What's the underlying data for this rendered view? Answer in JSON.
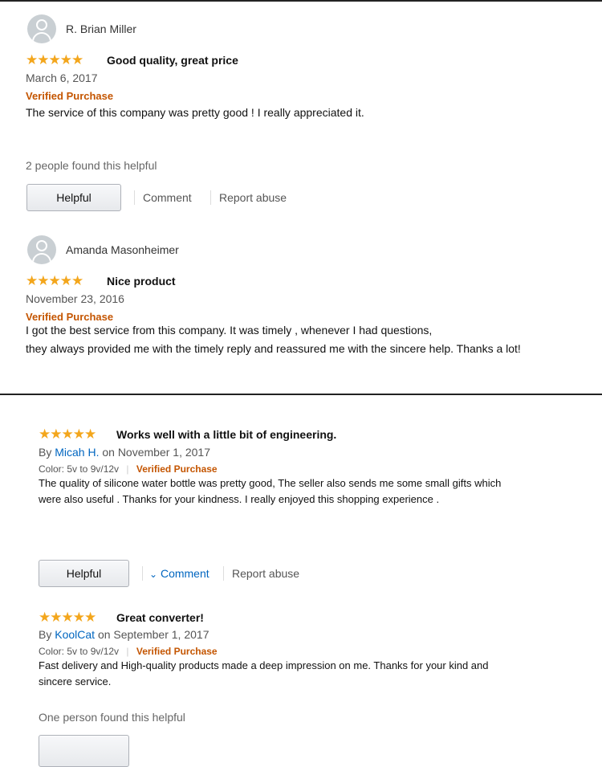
{
  "reviews_top": [
    {
      "reviewer": "R. Brian Miller",
      "rating": 5,
      "title": "Good quality, great price",
      "date": "March 6, 2017",
      "badge": "Verified Purchase",
      "text": "The service of this company was pretty good ! I really appreciated it.",
      "helpful_count": "2 people found this helpful",
      "actions": {
        "helpful": "Helpful",
        "comment": "Comment",
        "report": "Report abuse"
      }
    },
    {
      "reviewer": "Amanda Masonheimer",
      "rating": 5,
      "title": "Nice product",
      "date": "November 23, 2016",
      "badge": "Verified Purchase",
      "text_lines": [
        "I got the best service from this company. It was timely , whenever I had questions,",
        "they always provided me with the timely reply and reassured me with the sincere help. Thanks a lot!"
      ]
    }
  ],
  "reviews_bottom": [
    {
      "rating": 5,
      "title": "Works well with a little bit of engineering.",
      "by_prefix": "By",
      "author": "Micah H.",
      "date": "on November 1, 2017",
      "color_label": "Color: 5v to 9v/12v",
      "badge": "Verified Purchase",
      "text_lines": [
        "The quality of silicone water bottle was pretty good, The seller also sends me some small gifts which",
        "were also useful . Thanks for your kindness. I really enjoyed this shopping experience ."
      ],
      "actions": {
        "helpful": "Helpful",
        "comment": "Comment",
        "report": "Report abuse"
      }
    },
    {
      "rating": 5,
      "title": "Great converter!",
      "by_prefix": "By",
      "author": "KoolCat",
      "date": "on September 1, 2017",
      "color_label": "Color: 5v to 9v/12v",
      "badge": "Verified Purchase",
      "text_lines": [
        "Fast delivery and High-quality products made a deep impression on me. Thanks for your kind and",
        "sincere service."
      ],
      "helpful_count": "One person found this helpful"
    }
  ],
  "star_glyphs": "★★★★★",
  "chevron": "⌄",
  "colors": {
    "star": "#f3a61c",
    "verified": "#c45500",
    "link": "#0066c0"
  }
}
